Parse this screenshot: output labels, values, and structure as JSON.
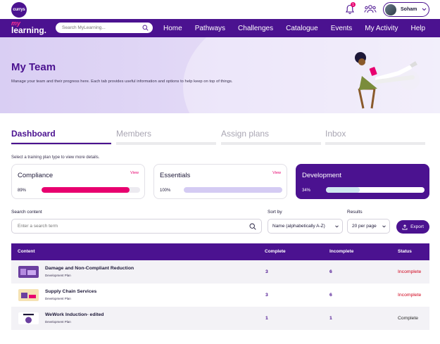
{
  "brand": {
    "logo_text": "currys"
  },
  "notifications": {
    "badge": "1"
  },
  "user": {
    "name": "Soham"
  },
  "nav": {
    "logo_my": "my",
    "logo_learning": "learning.",
    "search_placeholder": "Search MyLearning...",
    "links": [
      "Home",
      "Pathways",
      "Challenges",
      "Catalogue",
      "Events",
      "My Activity",
      "Help"
    ]
  },
  "hero": {
    "title": "My Team",
    "description": "Manage your team and their progress here. Each tab provides useful information and options to help keep on top of things."
  },
  "tabs": [
    {
      "label": "Dashboard",
      "active": true
    },
    {
      "label": "Members",
      "active": false
    },
    {
      "label": "Assign plans",
      "active": false
    },
    {
      "label": "Inbox",
      "active": false
    }
  ],
  "select_hint": "Select a training plan type to view more details.",
  "cards": [
    {
      "title": "Compliance",
      "view_label": "View",
      "percent_label": "89%",
      "progress": 0.89,
      "bar_color": "#e8006f"
    },
    {
      "title": "Essentials",
      "view_label": "View",
      "percent_label": "100%",
      "progress": 1.0,
      "bar_color": "#d4cbf3"
    },
    {
      "title": "Development",
      "view_label": "",
      "percent_label": "34%",
      "progress": 0.34,
      "bar_color": "#cfe6f0"
    }
  ],
  "filters": {
    "search_label": "Search content",
    "search_placeholder": "Enter a search term",
    "sort_label": "Sort by",
    "sort_value": "Name (alphabetically A-Z)",
    "results_label": "Results",
    "results_value": "20 per page",
    "export_label": "Export"
  },
  "table": {
    "headers": {
      "content": "Content",
      "complete": "Complete",
      "incomplete": "Incomplete",
      "status": "Status"
    },
    "rows": [
      {
        "title": "Damage and Non-Compliant Reduction",
        "subtitle": "Development Plan",
        "complete": "3",
        "incomplete": "6",
        "status": "Incomplete",
        "status_color": "#d0021b"
      },
      {
        "title": "Supply Chain Services",
        "subtitle": "Development Plan",
        "complete": "3",
        "incomplete": "6",
        "status": "Incomplete",
        "status_color": "#d0021b"
      },
      {
        "title": "WeWork Induction- edited",
        "subtitle": "Development Plan",
        "complete": "1",
        "incomplete": "1",
        "status": "Complete",
        "status_color": "#2b2b2b"
      }
    ]
  },
  "colors": {
    "brand_purple": "#4b1290",
    "accent_pink": "#e8006f"
  }
}
